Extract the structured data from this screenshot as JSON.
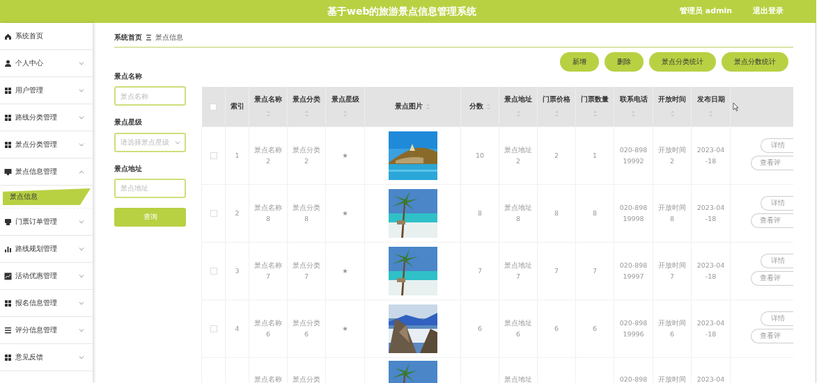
{
  "header": {
    "title": "基于web的旅游景点信息管理系统",
    "user": "管理员 admin",
    "logout": "退出登录"
  },
  "sidebar": {
    "items": [
      {
        "label": "系统首页",
        "kind": "home"
      },
      {
        "label": "个人中心",
        "kind": "user",
        "expanded": false
      },
      {
        "label": "用户管理",
        "kind": "grid",
        "expanded": false
      },
      {
        "label": "路线分类管理",
        "kind": "grid",
        "expanded": false
      },
      {
        "label": "景点分类管理",
        "kind": "grid",
        "expanded": false
      },
      {
        "label": "景点信息管理",
        "kind": "monitor",
        "expanded": true,
        "children": [
          {
            "label": "景点信息",
            "selected": true
          }
        ]
      },
      {
        "label": "门票订单管理",
        "kind": "printer",
        "expanded": false
      },
      {
        "label": "路线规划管理",
        "kind": "bars",
        "expanded": false
      },
      {
        "label": "活动优惠管理",
        "kind": "chart",
        "expanded": false
      },
      {
        "label": "报名信息管理",
        "kind": "grid",
        "expanded": false
      },
      {
        "label": "评分信息管理",
        "kind": "list",
        "expanded": false
      },
      {
        "label": "意见反馈",
        "kind": "grid",
        "expanded": false
      }
    ]
  },
  "breadcrumb": [
    "系统首页",
    "景点信息"
  ],
  "search": {
    "fields": [
      {
        "label": "景点名称",
        "placeholder": "景点名称",
        "kind": "input"
      },
      {
        "label": "景点星级",
        "placeholder": "请选择景点星级",
        "kind": "select"
      },
      {
        "label": "景点地址",
        "placeholder": "景点地址",
        "kind": "input"
      }
    ],
    "button": "查询"
  },
  "actions": [
    "新增",
    "删除",
    "景点分类统计",
    "景点分数统计"
  ],
  "table": {
    "header_checked": false,
    "columns": [
      {
        "label": "索引",
        "sortable": false
      },
      {
        "label": "景点名称",
        "sortable": true
      },
      {
        "label": "景点分类",
        "sortable": true
      },
      {
        "label": "景点星级",
        "sortable": true
      },
      {
        "label": "景点图片",
        "sortable": true
      },
      {
        "label": "分数",
        "sortable": true
      },
      {
        "label": "景点地址",
        "sortable": true
      },
      {
        "label": "门票价格",
        "sortable": true
      },
      {
        "label": "门票数量",
        "sortable": true
      },
      {
        "label": "联系电话",
        "sortable": true
      },
      {
        "label": "开放时间",
        "sortable": true
      },
      {
        "label": "发布日期",
        "sortable": true
      }
    ],
    "rows": [
      {
        "checked": false,
        "cells": [
          "1",
          "景点名称2",
          "景点分类2",
          "★",
          null,
          "10",
          "景点地址2",
          "2",
          "1",
          "020-89819992",
          "开放时间2",
          "2023-04-18"
        ],
        "buttons": [
          "详情",
          "查看评"
        ]
      },
      {
        "checked": false,
        "cells": [
          "2",
          "景点名称8",
          "景点分类8",
          "★",
          null,
          "8",
          "景点地址8",
          "8",
          "8",
          "020-89819998",
          "开放时间8",
          "2023-04-18"
        ],
        "buttons": [
          "详情",
          "查看评"
        ]
      },
      {
        "checked": false,
        "cells": [
          "3",
          "景点名称7",
          "景点分类7",
          "★",
          null,
          "7",
          "景点地址7",
          "7",
          "7",
          "020-89819997",
          "开放时间7",
          "2023-04-18"
        ],
        "buttons": [
          "详情",
          "查看评"
        ]
      },
      {
        "checked": false,
        "cells": [
          "4",
          "景点名称6",
          "景点分类6",
          "★",
          null,
          "6",
          "景点地址6",
          "6",
          "6",
          "020-89819996",
          "开放时间6",
          "2023-04-18"
        ],
        "buttons": [
          "详情",
          "查看评"
        ]
      },
      {
        "cells": [
          "",
          "景点名称",
          "景点分类",
          "",
          null,
          "",
          "景点地址",
          "",
          "",
          "020-898",
          "开放时间",
          "2023-04"
        ]
      }
    ]
  }
}
